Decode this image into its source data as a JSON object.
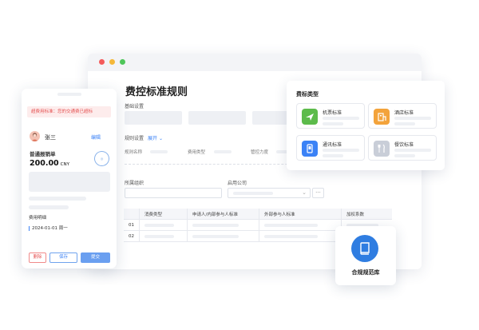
{
  "main": {
    "title": "费控标准规则",
    "basic_settings_label": "基础设置",
    "rule_settings_label": "规则设置",
    "rule_settings_toggle": "展开",
    "fields": [
      "规则名称",
      "费用类型",
      "管控力度"
    ],
    "org_label": "所属组织",
    "company_label": "启用公司",
    "more_button": "···",
    "table": {
      "headers": [
        "",
        "消费类型",
        "申请人/内部参与人标准",
        "外部参与人标准",
        "加权系数"
      ],
      "rows": [
        "01",
        "02"
      ]
    }
  },
  "type_panel": {
    "title": "费标类型",
    "items": [
      {
        "label": "机票标准",
        "icon": "plane-ticket-icon",
        "color": "#5cbb4b"
      },
      {
        "label": "酒店标准",
        "icon": "hotel-icon",
        "color": "#f3a33b"
      },
      {
        "label": "通讯标准",
        "icon": "phone-icon",
        "color": "#3b82f6"
      },
      {
        "label": "餐饮标准",
        "icon": "dining-icon",
        "color": "#c9ced8"
      }
    ]
  },
  "compliance": {
    "label": "合规规范库",
    "icon": "book-icon",
    "color": "#2f7de1"
  },
  "mobile": {
    "alert": "超费用标准：您的交通费已超标",
    "user_name": "张三",
    "edit_link": "编辑",
    "expense_type": "普通报销单",
    "amount_value": "200.00",
    "amount_currency": "CNY",
    "detail_label": "费用明细",
    "date": "2024-01-01 周一",
    "buttons": {
      "delete": "删除",
      "save": "保存",
      "submit": "提交"
    }
  }
}
